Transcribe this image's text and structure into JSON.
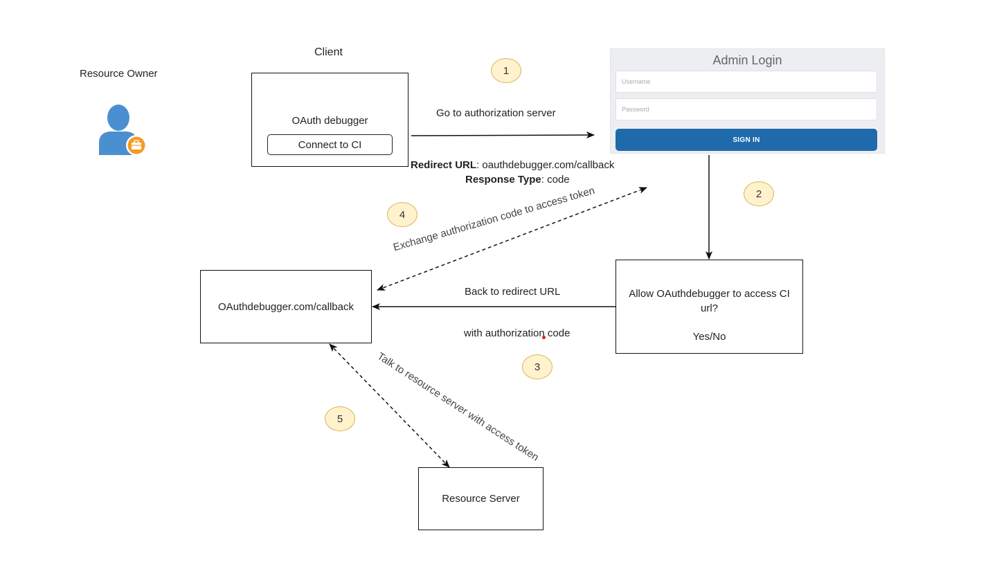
{
  "actors": {
    "resource_owner": {
      "label": "Resource Owner",
      "icon": "user-briefcase-icon",
      "colors": {
        "person": "#4a90d0",
        "badge": "#f59a23"
      }
    },
    "client": {
      "label": "Client"
    }
  },
  "nodes": {
    "client_box": {
      "title": "OAuth debugger",
      "button_label": "Connect to CI"
    },
    "callback_box": {
      "label": "OAuthdebugger.com/callback"
    },
    "consent_box": {
      "question": "Allow OAuthdebugger to access CI url?",
      "answer": "Yes/No"
    },
    "resource_server": {
      "label": "Resource Server"
    },
    "login_panel": {
      "title": "Admin Login",
      "username_placeholder": "Username",
      "password_placeholder": "Password",
      "sign_in_label": "SIGN IN",
      "button_color": "#1f6aab"
    }
  },
  "edges": {
    "to_auth_server": {
      "label": "Go to authorization server"
    },
    "redirect_info": {
      "redirect_key": "Redirect URL",
      "redirect_value": ": oauthdebugger.com/callback",
      "response_key": "Response Type",
      "response_value": ": code"
    },
    "exchange": {
      "label": "Exchange authorization code to access token"
    },
    "back_redirect": {
      "label": "Back to redirect URL",
      "sublabel": "with authorization code"
    },
    "talk_resource": {
      "label": "Talk to resource server with access token"
    }
  },
  "steps": [
    "1",
    "2",
    "3",
    "4",
    "5"
  ],
  "colors": {
    "step_fill": "#fff2cc",
    "step_border": "#d6b656",
    "line": "#111111"
  }
}
